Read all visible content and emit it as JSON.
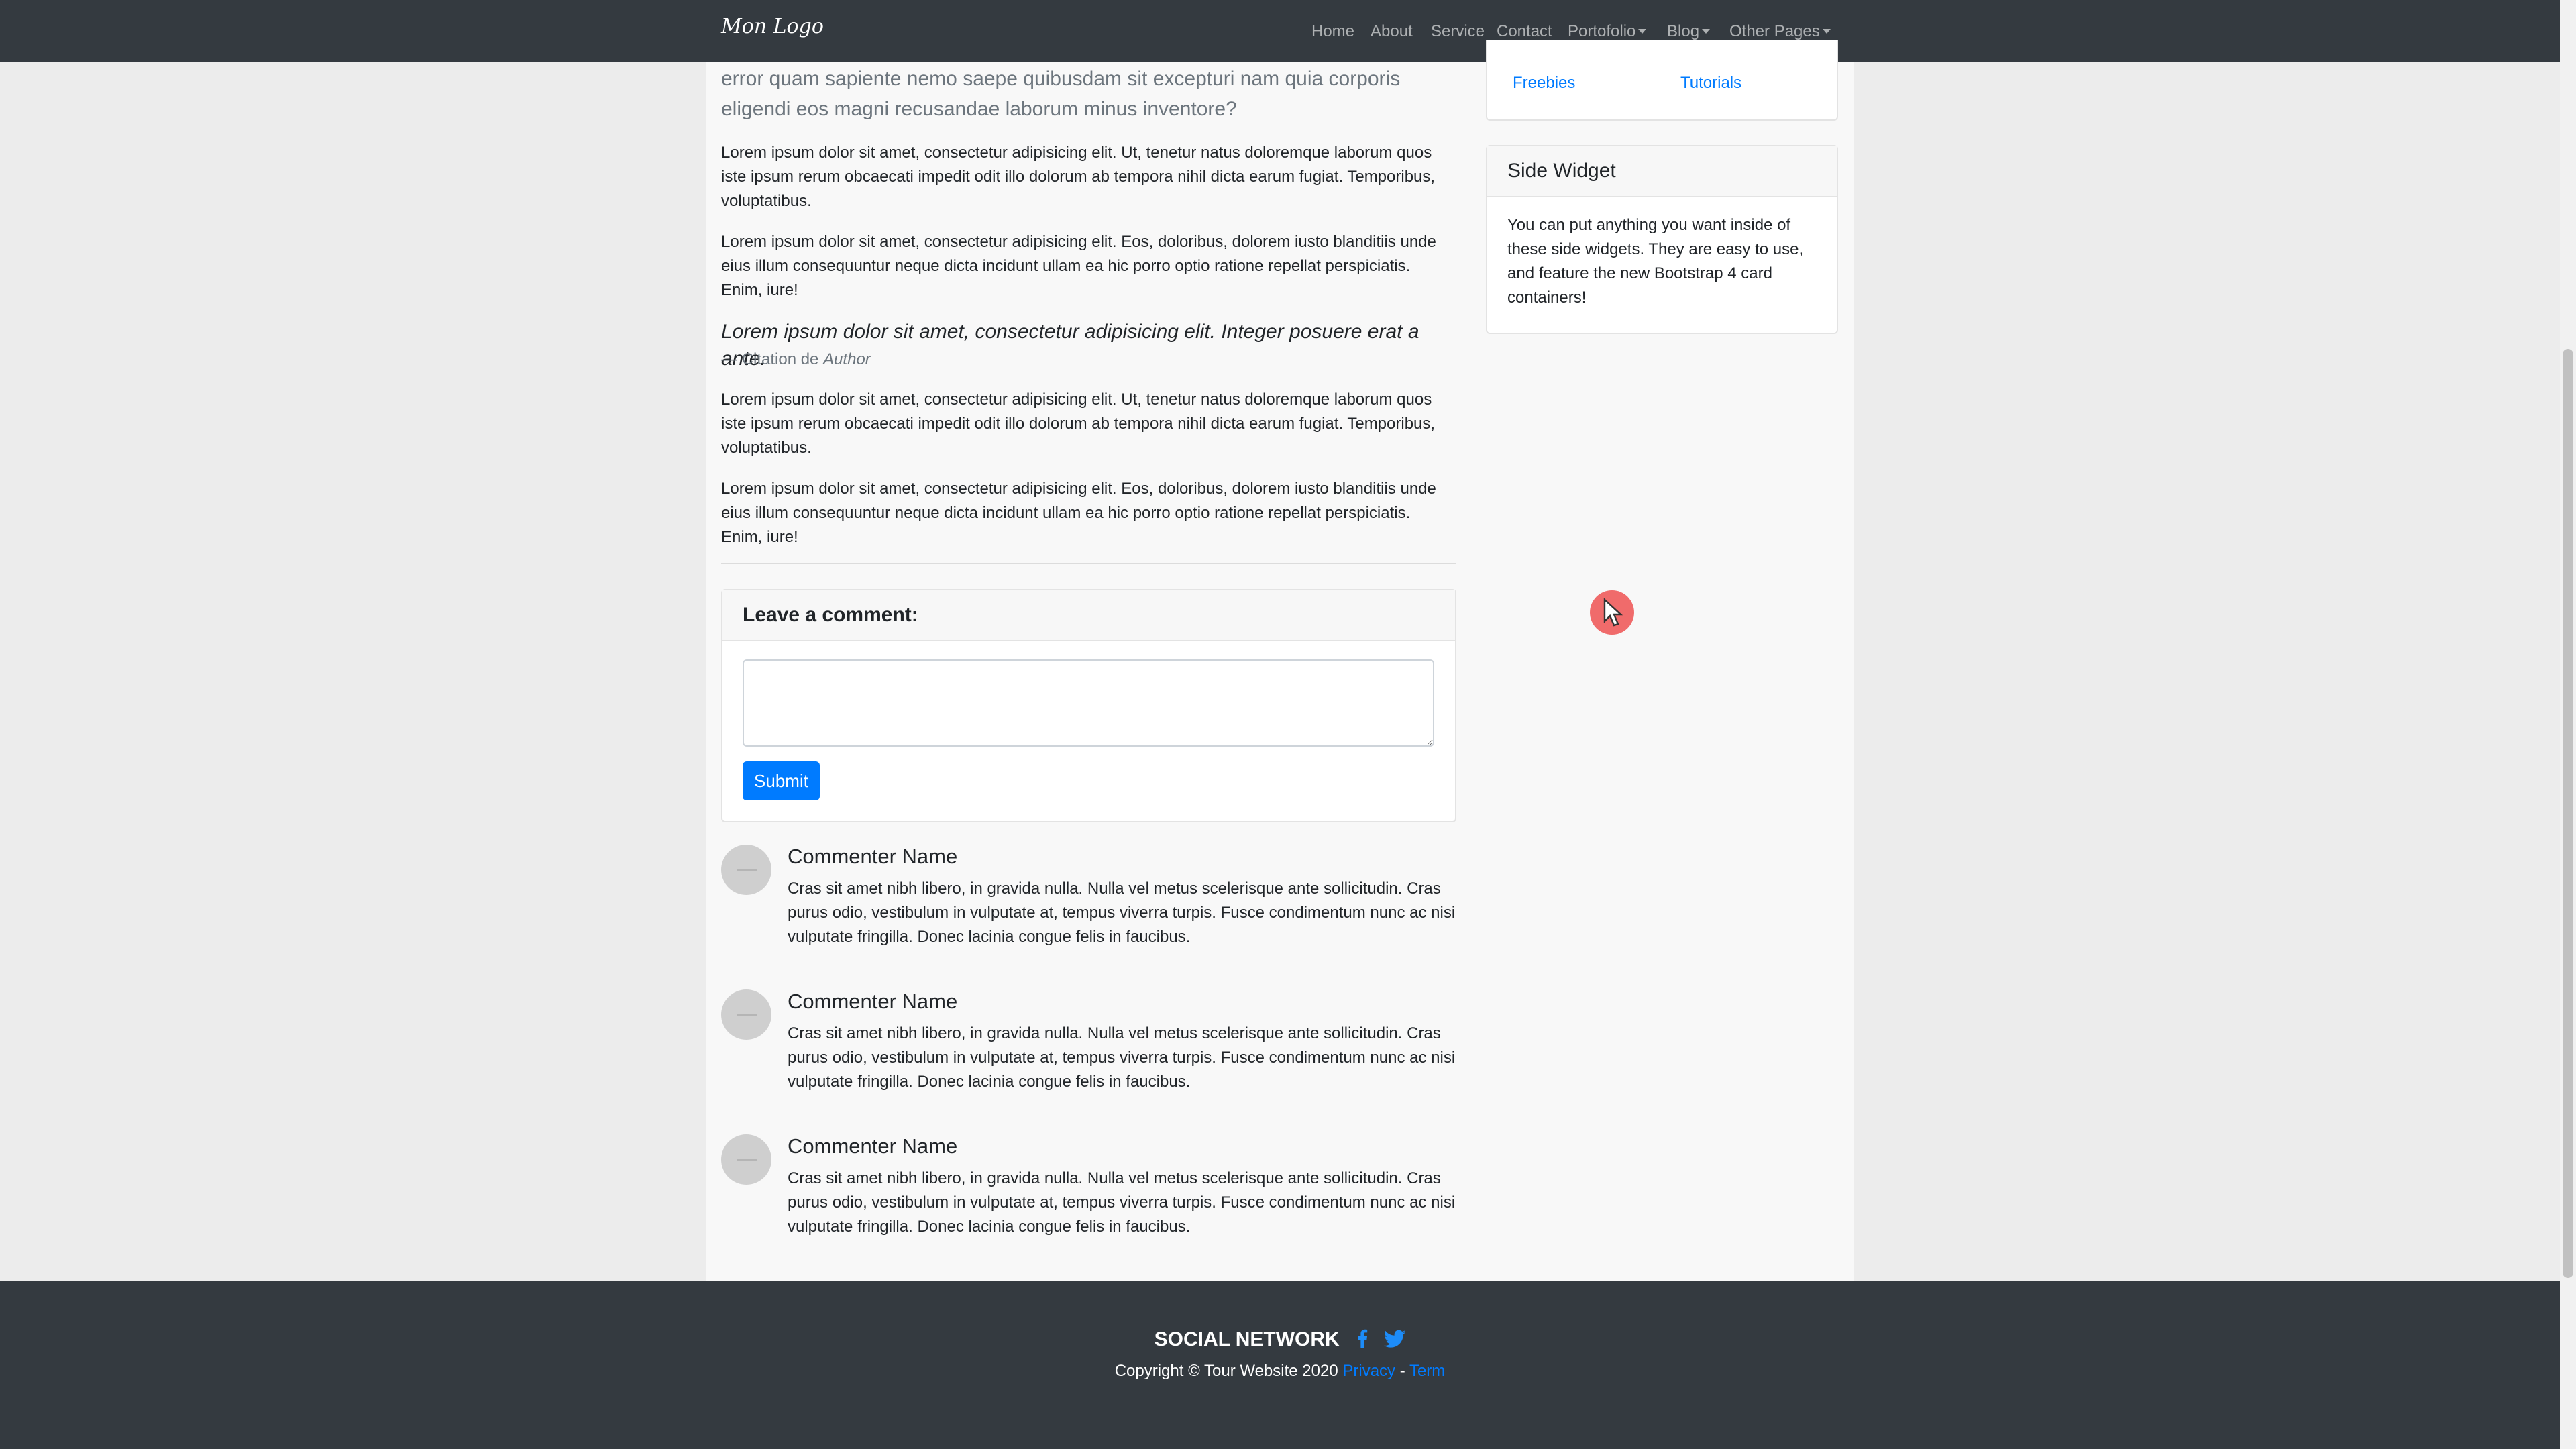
{
  "navbar": {
    "brand": "Mon Logo",
    "items": [
      {
        "label": "Home"
      },
      {
        "label": "About"
      },
      {
        "label": "Service"
      },
      {
        "label": "Contact"
      },
      {
        "label": "Portofolio"
      },
      {
        "label": "Blog"
      },
      {
        "label": "Other Pages"
      }
    ]
  },
  "post": {
    "lead_tail": "error quam sapiente nemo saepe quibusdam sit excepturi nam quia corporis eligendi eos magni recusandae laborum minus inventore?",
    "p1": "Lorem ipsum dolor sit amet, consectetur adipisicing elit. Ut, tenetur natus doloremque laborum quos iste ipsum rerum obcaecati impedit odit illo dolorum ab tempora nihil dicta earum fugiat. Temporibus, voluptatibus.",
    "p2": "Lorem ipsum dolor sit amet, consectetur adipisicing elit. Eos, doloribus, dolorem iusto blanditiis unde eius illum consequuntur neque dicta incidunt ullam ea hic porro optio ratione repellat perspiciatis. Enim, iure!",
    "quote": "Lorem ipsum dolor sit amet, consectetur adipisicing elit. Integer posuere erat a ante.",
    "quote_prefix": "— Citation de ",
    "quote_author": "Author",
    "p3": "Lorem ipsum dolor sit amet, consectetur adipisicing elit. Ut, tenetur natus doloremque laborum quos iste ipsum rerum obcaecati impedit odit illo dolorum ab tempora nihil dicta earum fugiat. Temporibus, voluptatibus.",
    "p4": "Lorem ipsum dolor sit amet, consectetur adipisicing elit. Eos, doloribus, dolorem iusto blanditiis unde eius illum consequuntur neque dicta incidunt ullam ea hic porro optio ratione repellat perspiciatis. Enim, iure!"
  },
  "comment_form": {
    "title": "Leave a comment:",
    "textarea_value": "",
    "submit_label": "Submit"
  },
  "comments": [
    {
      "name": "Commenter Name",
      "body": "Cras sit amet nibh libero, in gravida nulla. Nulla vel metus scelerisque ante sollicitudin. Cras purus odio, vestibulum in vulputate at, tempus viverra turpis. Fusce condimentum nunc ac nisi vulputate fringilla. Donec lacinia congue felis in faucibus."
    },
    {
      "name": "Commenter Name",
      "body": "Cras sit amet nibh libero, in gravida nulla. Nulla vel metus scelerisque ante sollicitudin. Cras purus odio, vestibulum in vulputate at, tempus viverra turpis. Fusce condimentum nunc ac nisi vulputate fringilla. Donec lacinia congue felis in faucibus."
    },
    {
      "name": "Commenter Name",
      "body": "Cras sit amet nibh libero, in gravida nulla. Nulla vel metus scelerisque ante sollicitudin. Cras purus odio, vestibulum in vulputate at, tempus viverra turpis. Fusce condimentum nunc ac nisi vulputate fringilla. Donec lacinia congue felis in faucibus."
    }
  ],
  "categories": {
    "links": [
      "Freebies",
      "Tutorials"
    ]
  },
  "side_widget": {
    "title": "Side Widget",
    "body": "You can put anything you want inside of these side widgets. They are easy to use, and feature the new Bootstrap 4 card containers!"
  },
  "footer": {
    "social_title": "SOCIAL NETWORK",
    "copyright": "Copyright © Tour Website 2020 ",
    "privacy": "Privacy",
    "separator": " - ",
    "term": "Term"
  },
  "icons": {
    "facebook": "facebook-icon",
    "twitter": "twitter-icon",
    "cursor": "mouse-cursor-icon"
  },
  "colors": {
    "navbar_bg": "#343a40",
    "link": "#007bff",
    "button": "#007bff",
    "cursor_highlight": "#f06b6b"
  }
}
